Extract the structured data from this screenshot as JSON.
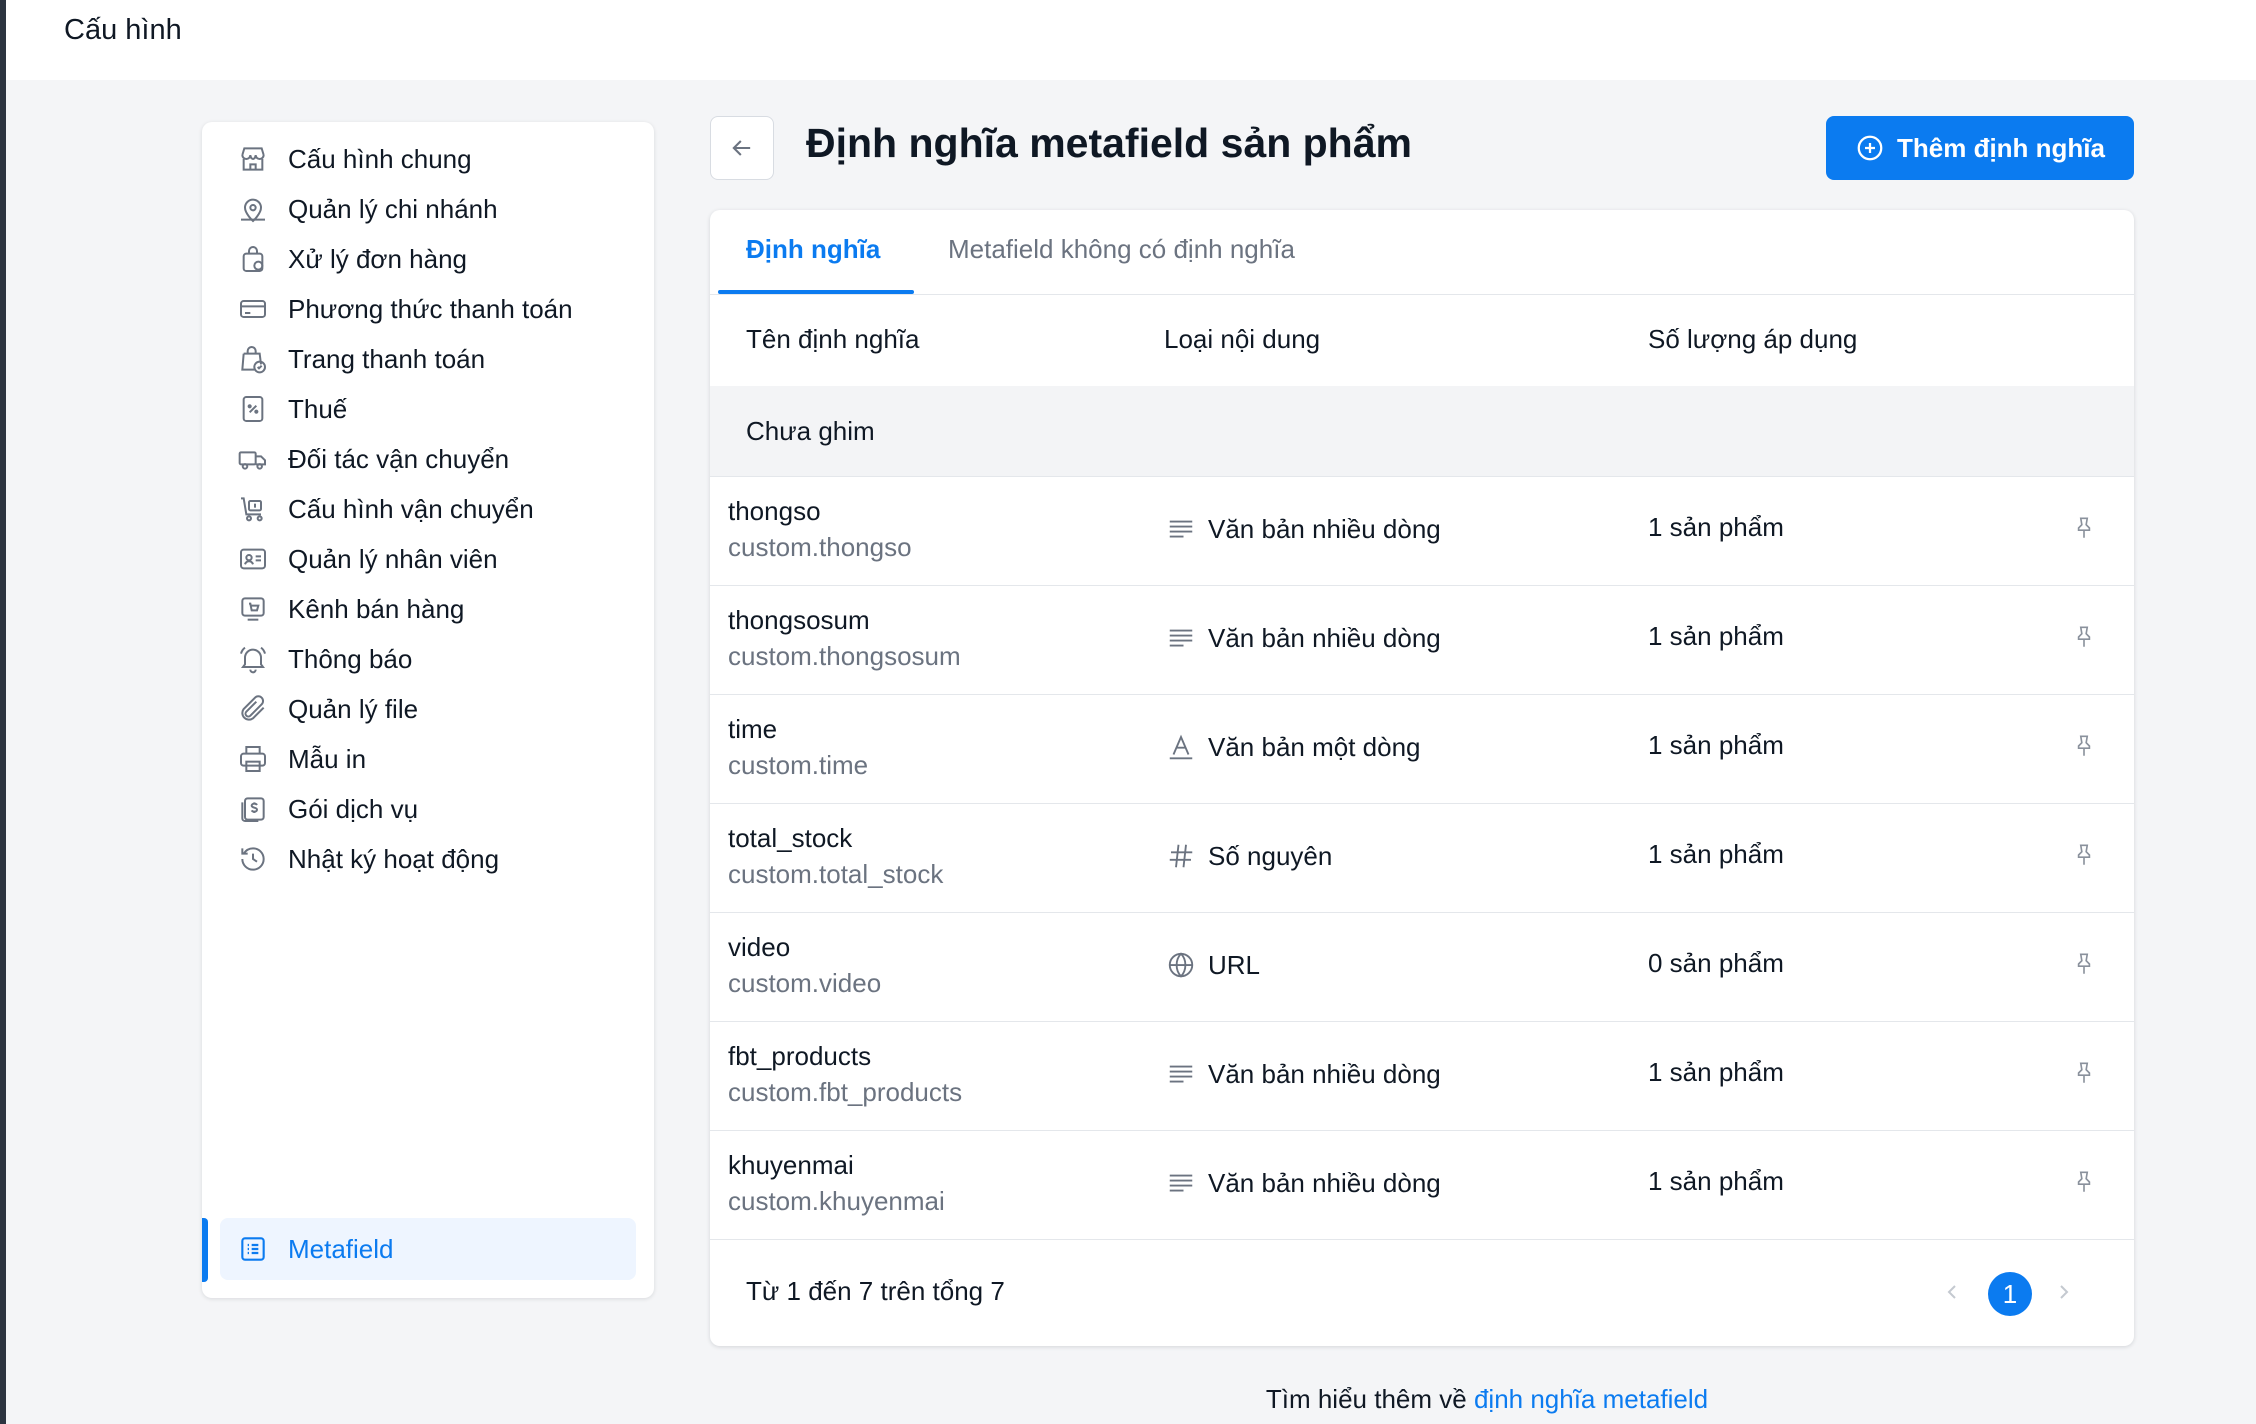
{
  "app": {
    "title": "Cấu hình"
  },
  "sidebar": {
    "items": [
      {
        "label": "Cấu hình chung",
        "icon": "store-icon"
      },
      {
        "label": "Quản lý chi nhánh",
        "icon": "branch-map-icon"
      },
      {
        "label": "Xử lý đơn hàng",
        "icon": "order-bag-icon"
      },
      {
        "label": "Phương thức thanh toán",
        "icon": "credit-card-icon"
      },
      {
        "label": "Trang thanh toán",
        "icon": "checkout-bag-icon"
      },
      {
        "label": "Thuế",
        "icon": "tax-receipt-icon"
      },
      {
        "label": "Đối tác vận chuyển",
        "icon": "truck-icon"
      },
      {
        "label": "Cấu hình vận chuyển",
        "icon": "shipping-cart-icon"
      },
      {
        "label": "Quản lý nhân viên",
        "icon": "id-card-icon"
      },
      {
        "label": "Kênh bán hàng",
        "icon": "sales-channel-icon"
      },
      {
        "label": "Thông báo",
        "icon": "bell-icon"
      },
      {
        "label": "Quản lý file",
        "icon": "paperclip-icon"
      },
      {
        "label": "Mẫu in",
        "icon": "printer-icon"
      },
      {
        "label": "Gói dịch vụ",
        "icon": "service-package-icon"
      },
      {
        "label": "Nhật ký hoạt động",
        "icon": "history-icon"
      },
      {
        "label": "Metafield",
        "icon": "metafield-list-icon",
        "active": true
      }
    ]
  },
  "header": {
    "title": "Định nghĩa metafield sản phẩm",
    "add_button": "Thêm định nghĩa"
  },
  "tabs": [
    {
      "label": "Định nghĩa",
      "active": true
    },
    {
      "label": "Metafield không có định nghĩa",
      "active": false
    }
  ],
  "table": {
    "columns": [
      "Tên định nghĩa",
      "Loại nội dung",
      "Số lượng áp dụng"
    ],
    "group_label": "Chưa ghim",
    "rows": [
      {
        "name": "thongso",
        "key": "custom.thongso",
        "type": "Văn bản nhiều dòng",
        "type_icon": "multiline-text-icon",
        "count": "1 sản phẩm"
      },
      {
        "name": "thongsosum",
        "key": "custom.thongsosum",
        "type": "Văn bản nhiều dòng",
        "type_icon": "multiline-text-icon",
        "count": "1 sản phẩm"
      },
      {
        "name": "time",
        "key": "custom.time",
        "type": "Văn bản một dòng",
        "type_icon": "single-line-text-icon",
        "count": "1 sản phẩm"
      },
      {
        "name": "total_stock",
        "key": "custom.total_stock",
        "type": "Số nguyên",
        "type_icon": "hash-icon",
        "count": "1 sản phẩm"
      },
      {
        "name": "video",
        "key": "custom.video",
        "type": "URL",
        "type_icon": "globe-icon",
        "count": "0 sản phẩm"
      },
      {
        "name": "fbt_products",
        "key": "custom.fbt_products",
        "type": "Văn bản nhiều dòng",
        "type_icon": "multiline-text-icon",
        "count": "1 sản phẩm"
      },
      {
        "name": "khuyenmai",
        "key": "custom.khuyenmai",
        "type": "Văn bản nhiều dòng",
        "type_icon": "multiline-text-icon",
        "count": "1 sản phẩm"
      }
    ],
    "summary": "Từ 1 đến 7 trên tổng 7",
    "current_page": "1"
  },
  "footer": {
    "text": "Tìm hiểu thêm về",
    "link": "định nghĩa metafield"
  },
  "colors": {
    "accent": "#0b7bf0",
    "text": "#0f1824",
    "muted": "#6b7380"
  }
}
